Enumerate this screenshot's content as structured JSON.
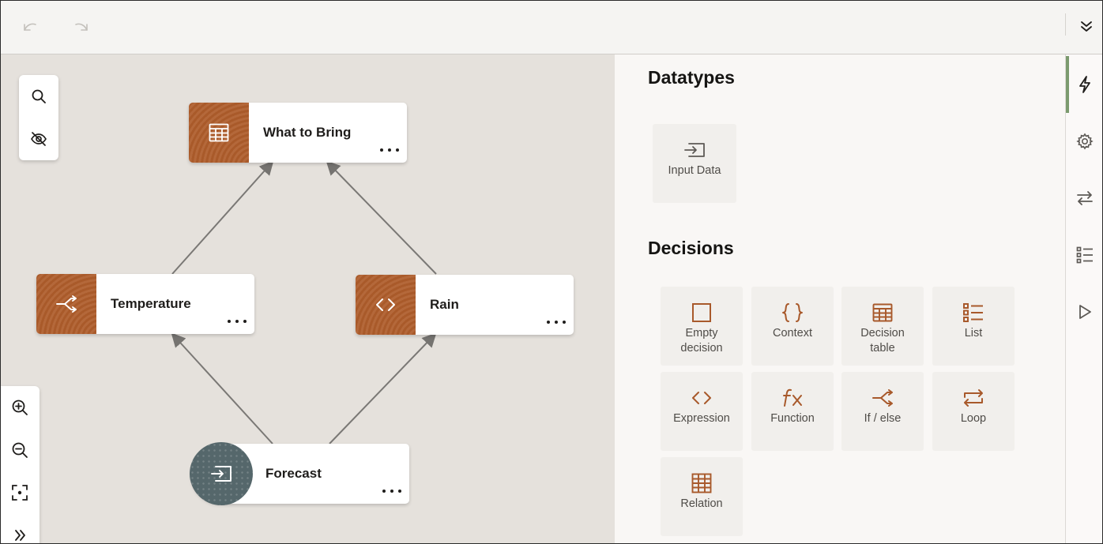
{
  "toolbar": {
    "undo_icon": "undo-icon",
    "redo_icon": "redo-icon",
    "collapse_icon": "chevrons-down-icon"
  },
  "canvas": {
    "tools_top": [
      "search-icon",
      "eye-off-icon"
    ],
    "tools_bottom": [
      "zoom-in-icon",
      "zoom-out-icon",
      "fit-to-screen-icon",
      "chevrons-right-icon"
    ],
    "nodes": {
      "what_to_bring": {
        "label": "What to Bring",
        "icon": "decision-table-icon"
      },
      "temperature": {
        "label": "Temperature",
        "icon": "if-else-icon"
      },
      "rain": {
        "label": "Rain",
        "icon": "expression-icon"
      },
      "forecast": {
        "label": "Forecast",
        "icon": "input-data-icon"
      }
    }
  },
  "palette": {
    "datatypes": {
      "title": "Datatypes",
      "items": [
        {
          "label": "Input Data",
          "icon": "input-data-icon"
        }
      ]
    },
    "decisions": {
      "title": "Decisions",
      "items": [
        {
          "label": "Empty decision",
          "icon": "square-icon"
        },
        {
          "label": "Context",
          "icon": "braces-icon"
        },
        {
          "label": "Decision table",
          "icon": "decision-table-icon"
        },
        {
          "label": "List",
          "icon": "list-icon"
        },
        {
          "label": "Expression",
          "icon": "expression-icon"
        },
        {
          "label": "Function",
          "icon": "function-icon"
        },
        {
          "label": "If / else",
          "icon": "if-else-icon"
        },
        {
          "label": "Loop",
          "icon": "loop-icon"
        },
        {
          "label": "Relation",
          "icon": "relation-icon"
        }
      ]
    }
  },
  "rail": {
    "items": [
      "lightning-icon",
      "gear-icon",
      "swap-icon",
      "checklist-icon",
      "play-icon"
    ],
    "active": "lightning-icon"
  },
  "colors": {
    "accent_brown": "#a8592b",
    "canvas_bg": "#e5e1dc",
    "rail_active": "#7b9a6e",
    "input_node": "#55676b"
  }
}
